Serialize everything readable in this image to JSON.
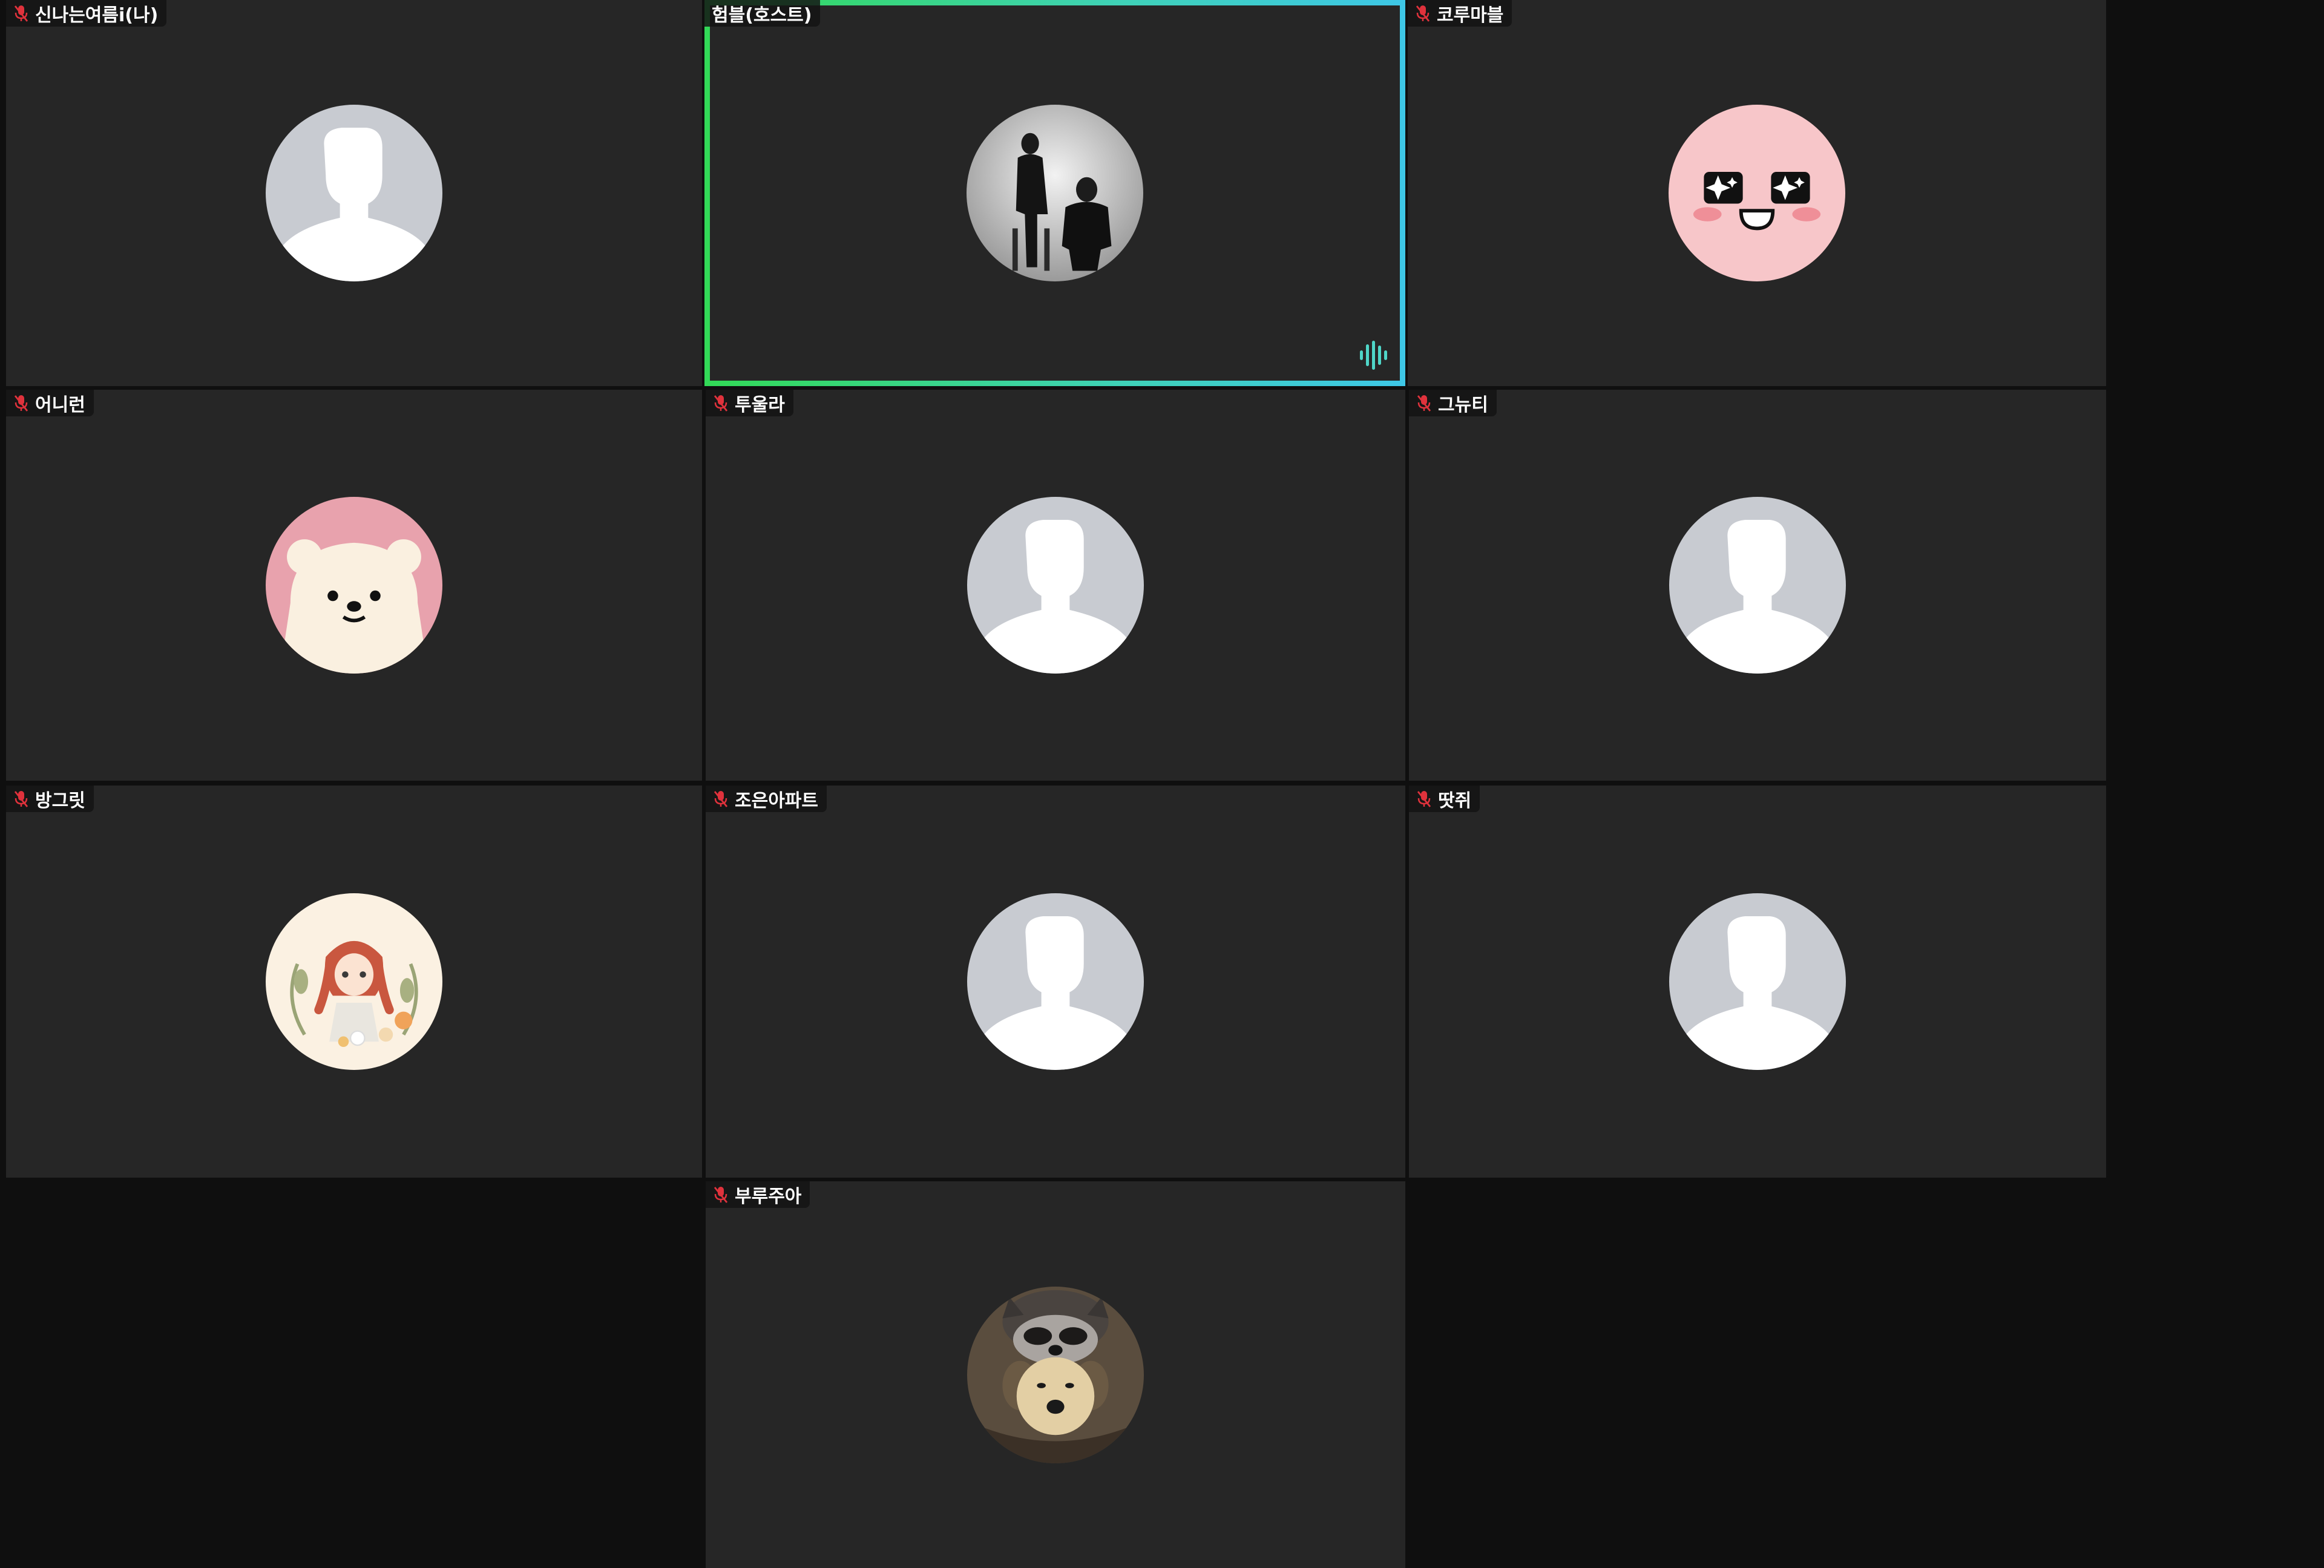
{
  "colors": {
    "background": "#0f0f0f",
    "tile": "#262626",
    "speaking_border_start": "#32d957",
    "speaking_border_end": "#3ec7e6",
    "mute_icon": "#e0323c",
    "default_avatar_bg": "#c8cbd1",
    "default_avatar_fg": "#ffffff"
  },
  "participants": [
    {
      "name": "신나는여름i(나)",
      "muted": true,
      "speaking": false,
      "avatar": "default-person-icon"
    },
    {
      "name": "험블(호스트)",
      "muted": false,
      "speaking": true,
      "avatar": "couple-photo"
    },
    {
      "name": "코루마블",
      "muted": true,
      "speaking": false,
      "avatar": "sparkly-eyes-face"
    },
    {
      "name": "어니런",
      "muted": true,
      "speaking": false,
      "avatar": "cream-bear"
    },
    {
      "name": "투울라",
      "muted": true,
      "speaking": false,
      "avatar": "default-person-icon"
    },
    {
      "name": "그뉴티",
      "muted": true,
      "speaking": false,
      "avatar": "default-person-icon"
    },
    {
      "name": "방그릿",
      "muted": true,
      "speaking": false,
      "avatar": "anne-illustration"
    },
    {
      "name": "조은아파트",
      "muted": true,
      "speaking": false,
      "avatar": "default-person-icon"
    },
    {
      "name": "땃쥐",
      "muted": true,
      "speaking": false,
      "avatar": "default-person-icon"
    },
    {
      "name": "부루주아",
      "muted": true,
      "speaking": false,
      "avatar": "raccoon-dog-photo"
    }
  ]
}
